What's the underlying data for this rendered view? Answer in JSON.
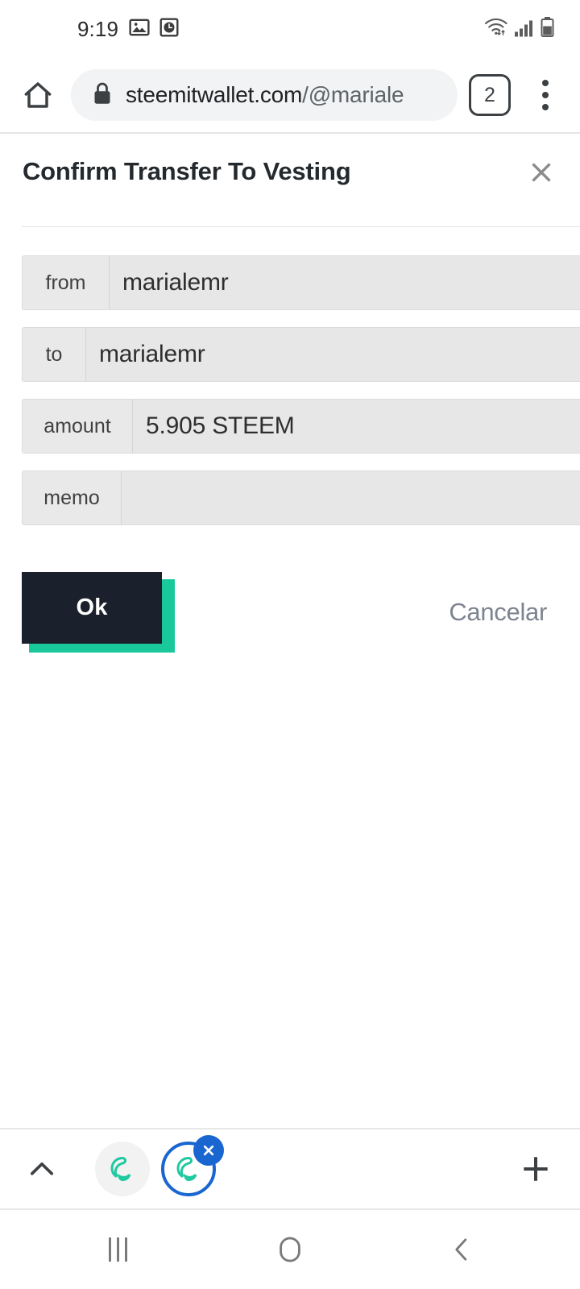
{
  "status_bar": {
    "time": "9:19",
    "left_icons": [
      "gallery-icon",
      "alarm-clock-icon"
    ],
    "right_icons": [
      "wifi-icon",
      "cellular-signal-icon",
      "battery-icon"
    ]
  },
  "browser": {
    "home_icon": "home-icon",
    "lock_icon": "lock-icon",
    "url_domain": "steemitwallet.com",
    "url_path": "/@mariale",
    "url_full": "steemitwallet.com/@mariale",
    "tab_count": "2",
    "menu_icon": "overflow-menu-icon"
  },
  "dialog": {
    "title": "Confirm Transfer To Vesting",
    "close_icon": "close-icon",
    "rows": [
      {
        "label": "from",
        "value": "marialemr"
      },
      {
        "label": "to",
        "value": "marialemr"
      },
      {
        "label": "amount",
        "value": "5.905 STEEM"
      },
      {
        "label": "memo",
        "value": ""
      }
    ],
    "ok_label": "Ok",
    "cancel_label": "Cancelar"
  },
  "tab_strip": {
    "expand_icon": "chevron-up-icon",
    "new_tab_icon": "plus-icon",
    "tabs": [
      {
        "name": "steem-tab-1",
        "active": false,
        "favicon": "steem-logo-icon"
      },
      {
        "name": "steem-tab-2",
        "active": true,
        "favicon": "steem-logo-icon",
        "close_icon": "close-circle-icon"
      }
    ]
  },
  "nav_bar": {
    "recents_icon": "recents-icon",
    "home_icon": "home-circle-icon",
    "back_icon": "back-chevron-icon"
  },
  "colors": {
    "accent_teal": "#19c89b",
    "button_dark": "#1a202c",
    "tab_active_blue": "#1a66d0",
    "field_bg": "#e7e7e7"
  }
}
